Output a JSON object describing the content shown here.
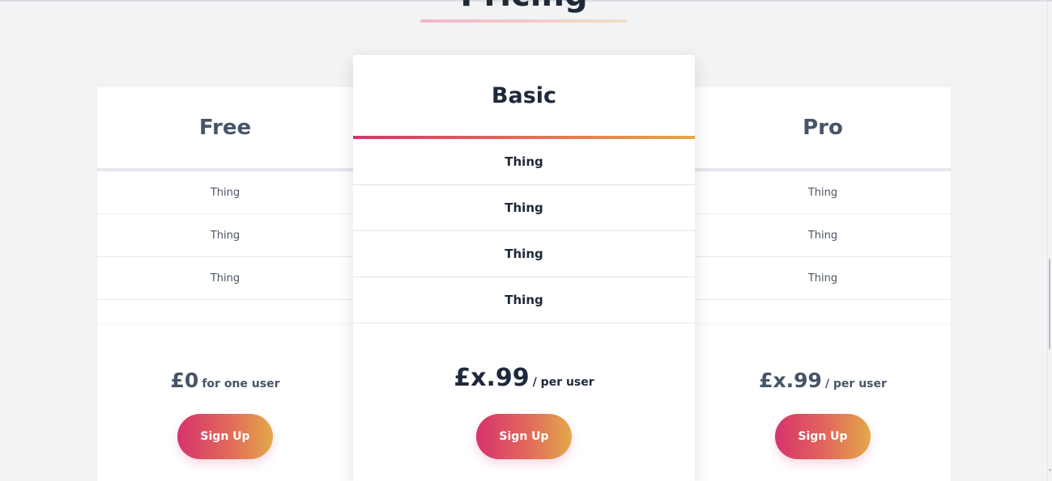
{
  "page": {
    "heading": "Pricing"
  },
  "plans": [
    {
      "name": "Free",
      "features": [
        "Thing",
        "Thing",
        "Thing"
      ],
      "price": "£0",
      "price_suffix": "for one user",
      "button": "Sign Up"
    },
    {
      "name": "Basic",
      "features": [
        "Thing",
        "Thing",
        "Thing",
        "Thing"
      ],
      "price": "£x.99",
      "price_suffix": "/ per user",
      "button": "Sign Up",
      "featured": true
    },
    {
      "name": "Pro",
      "features": [
        "Thing",
        "Thing",
        "Thing"
      ],
      "price": "£x.99",
      "price_suffix": "/ per user",
      "button": "Sign Up"
    }
  ],
  "colors": {
    "accent_start": "#d6336c",
    "accent_end": "#e3a94a",
    "background": "#f2f3f5"
  }
}
